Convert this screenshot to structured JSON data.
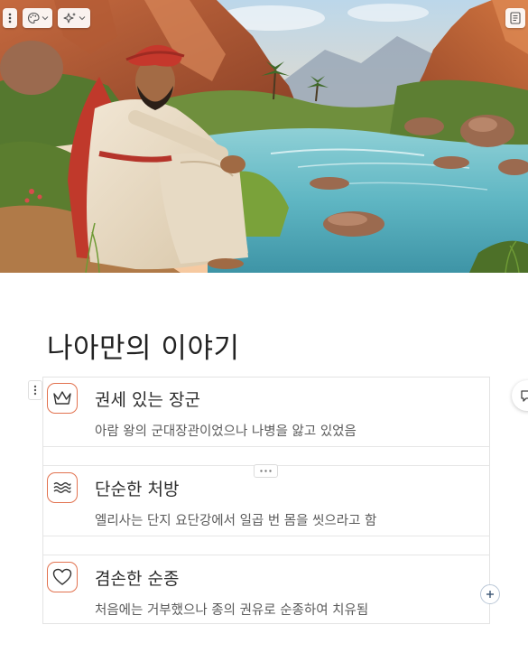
{
  "toolbar": {
    "drag_icon": "vertical-dots-icon",
    "style_icon": "palette-icon",
    "ai_icon": "sparkle-icon",
    "dropdown_icon": "chevron-down-icon",
    "notes_icon": "document-icon"
  },
  "page": {
    "title": "나아만의 이야기"
  },
  "list": {
    "accent_color": "#e2724f",
    "items": [
      {
        "icon": "crown-icon",
        "title": "권세 있는 장군",
        "description": "아람 왕의 군대장관이었으나 나병을 앓고 있었음"
      },
      {
        "icon": "waves-icon",
        "title": "단순한 처방",
        "description": "엘리사는 단지 요단강에서 일곱 번 몸을 씻으라고 함"
      },
      {
        "icon": "heart-icon",
        "title": "겸손한 순종",
        "description": "처음에는 거부했으나 종의 권유로 순종하여 치유됨"
      }
    ]
  },
  "controls": {
    "block_handle_icon": "vertical-dots-icon",
    "more_icon": "horizontal-dots-icon",
    "add_icon": "plus-icon",
    "comment_icon": "comment-icon"
  }
}
